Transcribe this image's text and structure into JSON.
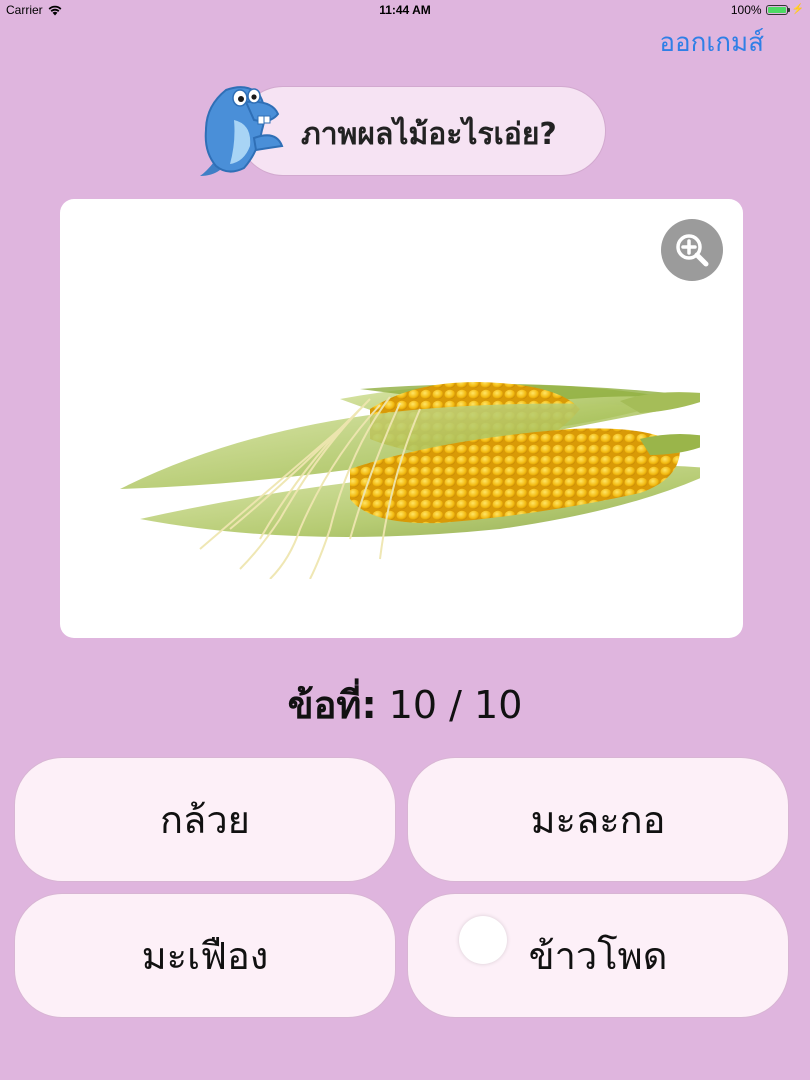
{
  "status_bar": {
    "carrier": "Carrier",
    "time": "11:44 AM",
    "battery": "100%",
    "battery_level": 1.0
  },
  "header": {
    "exit_label": "ออกเกมส์"
  },
  "question": {
    "prompt": "ภาพผลไม้อะไรเอ่ย?",
    "mascot_icon": "dolphin-mascot-icon"
  },
  "picture": {
    "subject_icon": "corn-image",
    "zoom_icon": "zoom-in-icon"
  },
  "progress": {
    "label": "ข้อที่:",
    "value": "10 / 10",
    "current": 10,
    "total": 10
  },
  "answers": [
    {
      "label": "กล้วย"
    },
    {
      "label": "มะละกอ"
    },
    {
      "label": "มะเฟือง"
    },
    {
      "label": "ข้าวโพด"
    }
  ],
  "colors": {
    "background": "#dfb5de",
    "accent": "#2f7fe6",
    "button_bg": "#fdf0f8",
    "bubble_bg": "#f6e3f3",
    "zoom_button": "#9b9b9b"
  }
}
